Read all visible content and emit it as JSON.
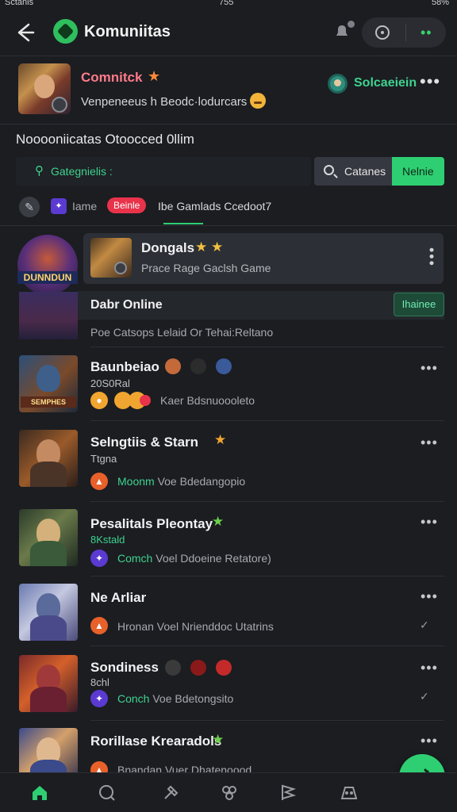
{
  "status_bar": {
    "carrier": "Sctanis",
    "time": "755",
    "right": "58%"
  },
  "header": {
    "title": "Komuniitas",
    "back_icon": "arrow-left-icon"
  },
  "profile": {
    "name": "Comnitck",
    "subtitle": "Venpeneeus h Beodc·lodurcars",
    "action": "Solcaeiein"
  },
  "section": {
    "title": "Nooooniicatas Otoocced 0llim"
  },
  "filter": {
    "label": "Gategnielis :",
    "search_label": "Catanes",
    "new_label": "Nelnie"
  },
  "tabs": {
    "name": "Iame",
    "badge": "Beinle",
    "active": "Ibe Gamlads Ccedoot7"
  },
  "popup": {
    "title": "Dongals",
    "stars": "★ ★",
    "subtitle": "Prace Rage Gaclsh Game"
  },
  "featured": {
    "logo": "DUNNDUN",
    "title": "Dabr Online",
    "button": "Ihainee",
    "subtitle": "Poe Catsops Lelaid Or Tehai:Reltano"
  },
  "games": [
    {
      "title": "Baunbeiao",
      "subtitle": "20S0Ral",
      "meta_highlight": "",
      "meta": "Kaer Bdsnuoooleto",
      "thumb_tag": "SEMPHES",
      "end": "more"
    },
    {
      "title": "Selngtiis & Starn",
      "subtitle": "Ttgna",
      "meta_highlight": "Moonm",
      "meta": " Voe Bdedangopio",
      "thumb_tag": "",
      "end": "more"
    },
    {
      "title": "Pesalitals Pleontay",
      "subtitle": "8Kstald",
      "meta_highlight": "Comch",
      "meta": " Voel Ddoeine Retatore)",
      "thumb_tag": "",
      "end": "more"
    },
    {
      "title": "Ne Arliar",
      "subtitle": "",
      "meta_highlight": "",
      "meta": "Hronan Voel Nrienddoc Utatrins",
      "thumb_tag": "",
      "end": "check"
    },
    {
      "title": "Sondiness",
      "subtitle": "8chl",
      "meta_highlight": "Conch",
      "meta": " Voe Bdetongsito",
      "thumb_tag": "",
      "end": "check"
    },
    {
      "title": "Rorillase Krearadols",
      "subtitle": "",
      "meta_highlight": "",
      "meta": "Bnandan Vuer Dhatenoood",
      "thumb_tag": "",
      "end": "more"
    }
  ],
  "colors": {
    "accent": "#2ecf72",
    "background": "#1b1d21",
    "badge": "#e8334a"
  },
  "nav": [
    "home-icon",
    "chat-icon",
    "hammer-icon",
    "group-icon",
    "flag-icon",
    "gamepad-icon"
  ]
}
